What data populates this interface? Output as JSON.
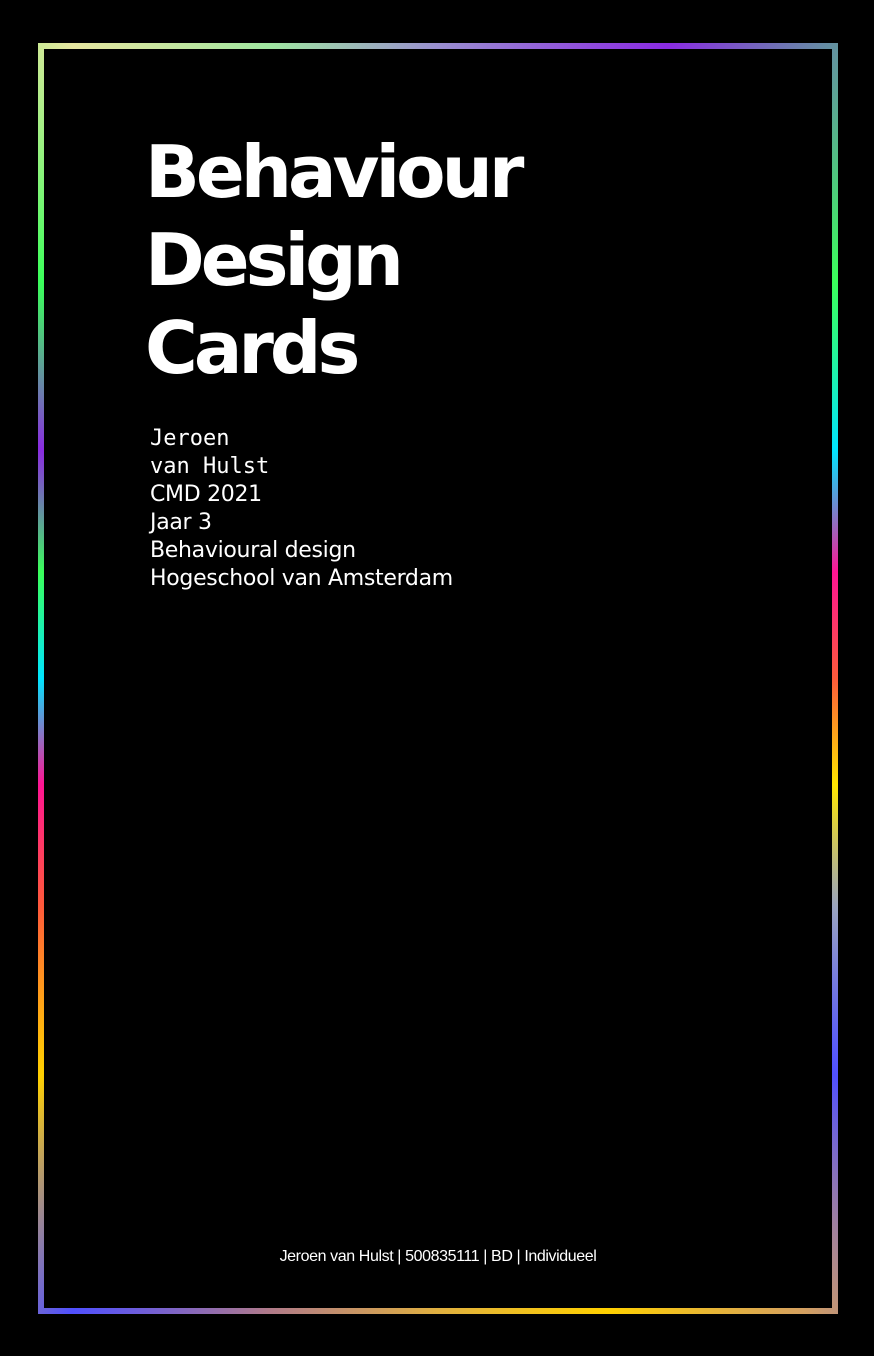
{
  "cover": {
    "title_lines": [
      "Behaviour",
      "Design",
      "Cards"
    ],
    "author_first": "Jeroen",
    "author_last": "van Hulst",
    "info_lines": [
      "CMD 2021",
      "Jaar 3",
      "Behavioural design",
      "Hogeschool van Amsterdam"
    ],
    "footer": "Jeroen van Hulst | 500835111 | BD | Individueel"
  },
  "colors": {
    "background": "#000000",
    "text": "#ffffff",
    "frame_gradient": [
      "#8a2be2",
      "#3aff5a",
      "#00e5ff",
      "#ff1493",
      "#ff5a3a",
      "#ffe600",
      "#5050ff",
      "#ffd000"
    ]
  }
}
